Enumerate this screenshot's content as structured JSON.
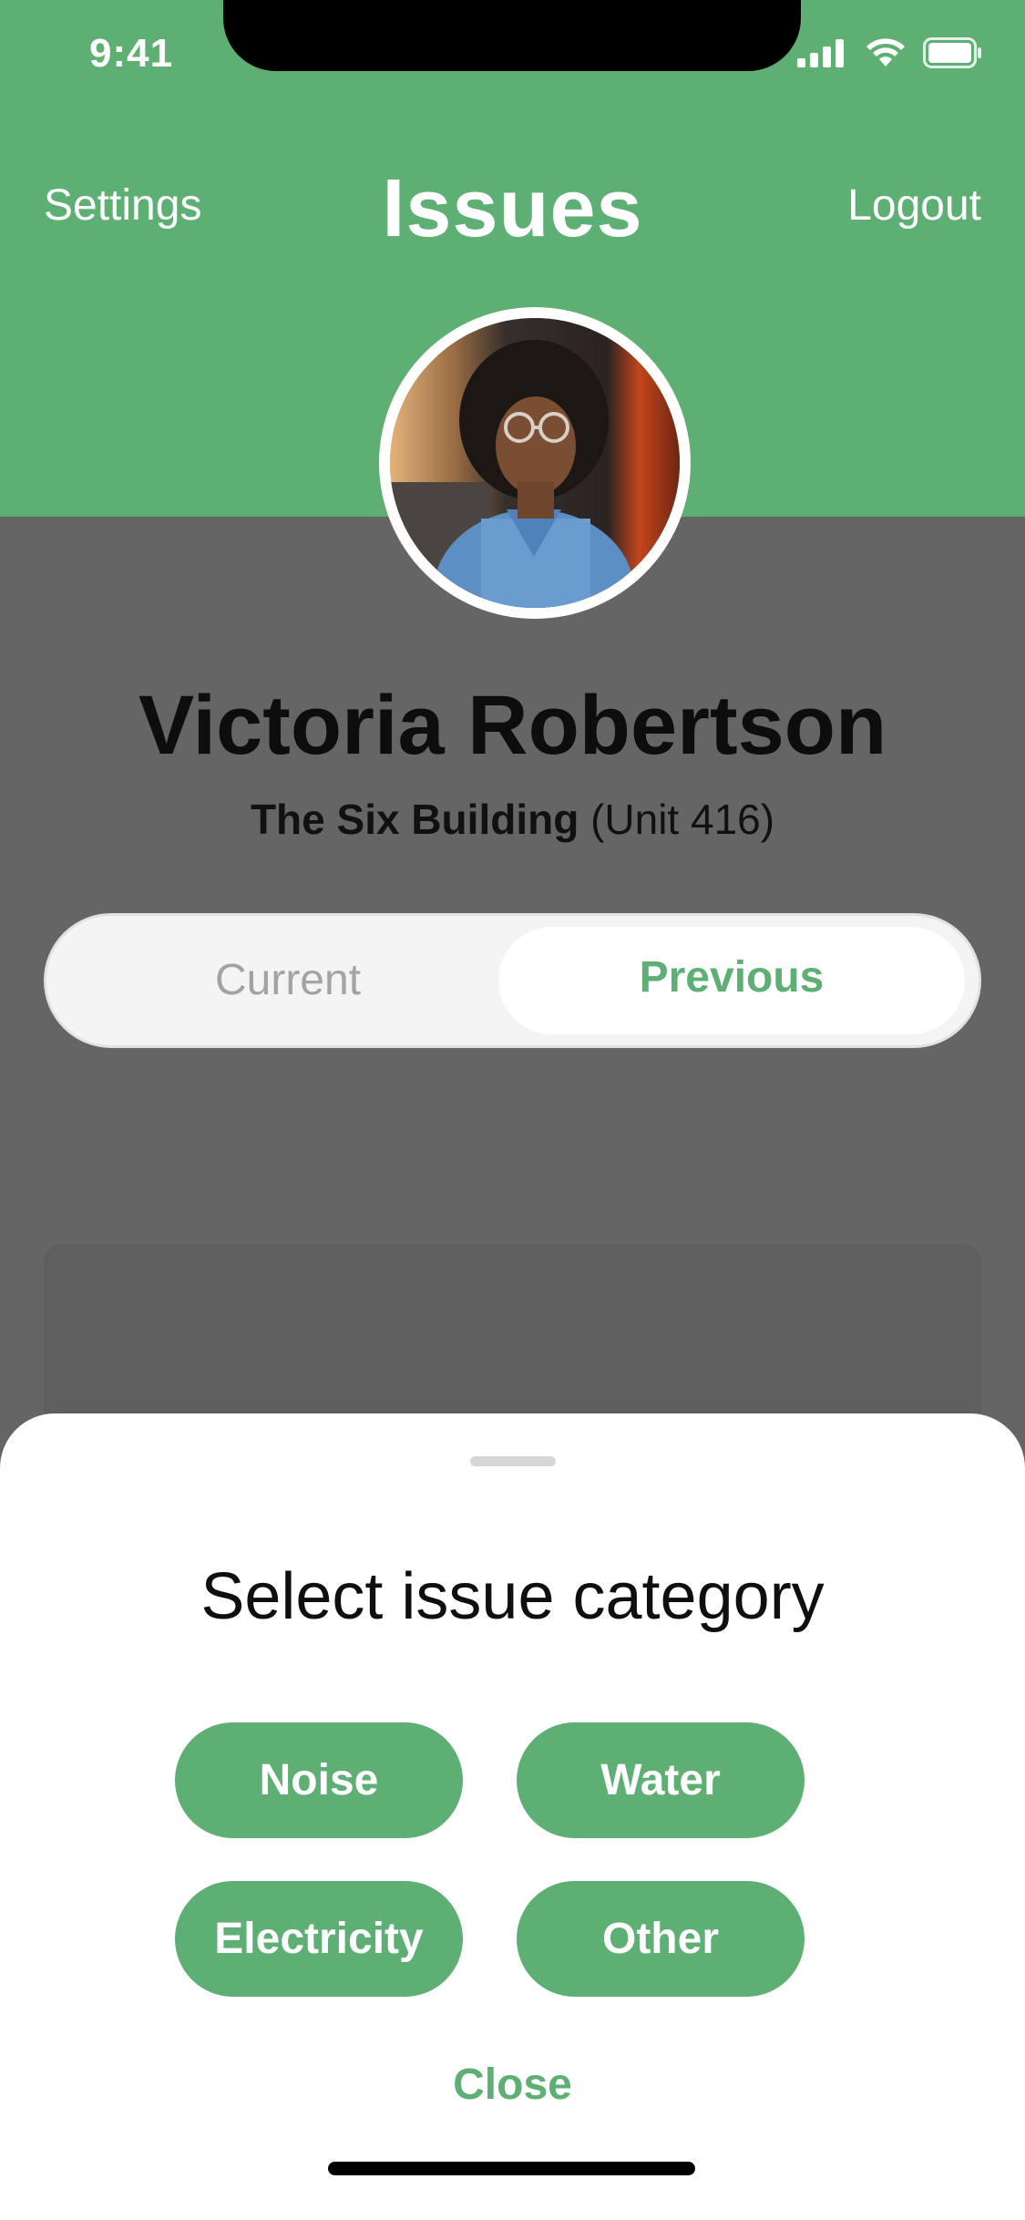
{
  "status_bar": {
    "time": "9:41"
  },
  "header": {
    "left_action": "Settings",
    "title": "Issues",
    "right_action": "Logout",
    "background_color": "#5DAF73"
  },
  "profile": {
    "name": "Victoria Robertson",
    "building": "The Six Building",
    "unit": "(Unit 416)"
  },
  "segmented_control": {
    "options": [
      "Current",
      "Previous"
    ],
    "selected": "Previous"
  },
  "sheet": {
    "title": "Select issue category",
    "categories": [
      "Noise",
      "Water",
      "Electricity",
      "Other"
    ],
    "close_label": "Close"
  },
  "colors": {
    "accent": "#5DAF73",
    "overlay": "#656565"
  }
}
